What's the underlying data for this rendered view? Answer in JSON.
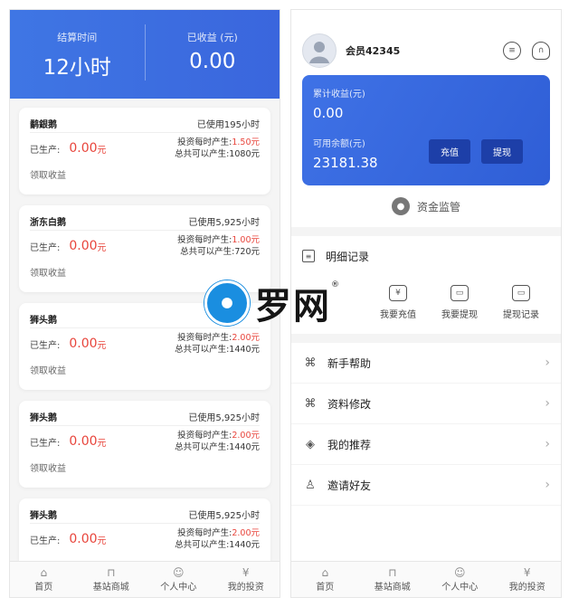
{
  "left": {
    "hero": {
      "settle_label": "结算时间",
      "settle_value": "12小时",
      "earned_label": "已收益 (元)",
      "earned_value": "0.00"
    },
    "cards": [
      {
        "name": "鹬銀鹅",
        "used": "已使用195小时",
        "produced_label": "已生产:",
        "produced_amount": "0.00",
        "unit": "元",
        "rate_label": "投资每时产生:",
        "rate_value": "1.50元",
        "total": "总共可以产生:1080元",
        "claim": "领取收益"
      },
      {
        "name": "浙东白鹅",
        "used": "已使用5,925小时",
        "produced_label": "已生产:",
        "produced_amount": "0.00",
        "unit": "元",
        "rate_label": "投资每时产生:",
        "rate_value": "1.00元",
        "total": "总共可以产生:720元",
        "claim": "领取收益"
      },
      {
        "name": "狮头鹅",
        "used": "",
        "produced_label": "已生产:",
        "produced_amount": "0.00",
        "unit": "元",
        "rate_label": "投资每时产生:",
        "rate_value": "2.00元",
        "total": "总共可以产生:1440元",
        "claim": "领取收益"
      },
      {
        "name": "狮头鹅",
        "used": "已使用5,925小时",
        "produced_label": "已生产:",
        "produced_amount": "0.00",
        "unit": "元",
        "rate_label": "投资每时产生:",
        "rate_value": "2.00元",
        "total": "总共可以产生:1440元",
        "claim": "领取收益"
      },
      {
        "name": "狮头鹅",
        "used": "已使用5,925小时",
        "produced_label": "已生产:",
        "produced_amount": "0.00",
        "unit": "元",
        "rate_label": "投资每时产生:",
        "rate_value": "2.00元",
        "total": "总共可以产生:1440元",
        "claim": ""
      }
    ],
    "tabs": [
      "首页",
      "基站商城",
      "个人中心",
      "我的投资"
    ]
  },
  "right": {
    "member": "会员42345",
    "balance": {
      "total_label": "累计收益(元)",
      "total_value": "0.00",
      "available_label": "可用余额(元)",
      "available_value": "23181.38",
      "recharge_btn": "充值",
      "withdraw_btn": "提现"
    },
    "custody": "资金监管",
    "detail": "明细记录",
    "quick": [
      "我要充值",
      "我要提现",
      "提现记录"
    ],
    "menu": [
      "新手帮助",
      "资料修改",
      "我的推荐",
      "邀请好友"
    ],
    "tabs": [
      "首页",
      "基站商城",
      "个人中心",
      "我的投资"
    ]
  },
  "watermark": {
    "text": "罗网",
    "reg": "®"
  },
  "colors": {
    "accent_blue": "#3a6ae0",
    "red": "#e8453c",
    "dark_button": "#1d3fa8"
  }
}
